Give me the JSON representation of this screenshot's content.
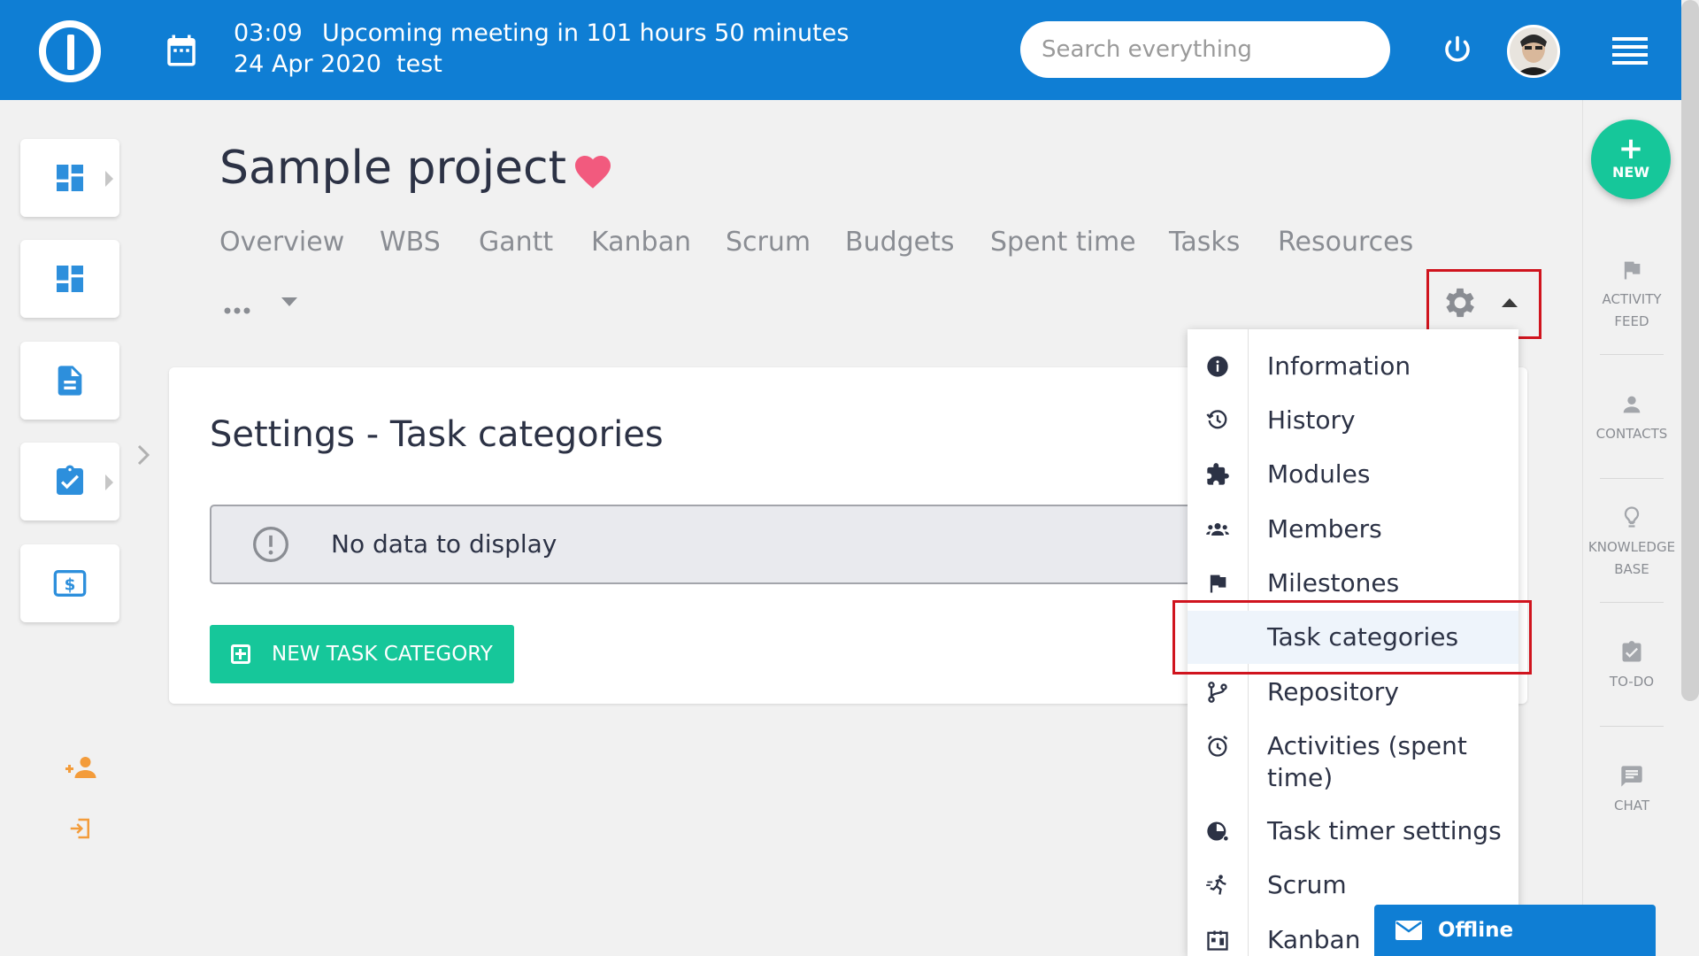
{
  "header": {
    "time": "03:09",
    "meeting": "Upcoming meeting in 101 hours 50 minutes",
    "date": "24 Apr 2020",
    "project": "test",
    "search_placeholder": "Search everything"
  },
  "page": {
    "title": "Sample project",
    "tabs": [
      "Overview",
      "WBS",
      "Gantt",
      "Kanban",
      "Scrum",
      "Budgets",
      "Spent time",
      "Tasks",
      "Resources"
    ],
    "more": "..."
  },
  "card": {
    "title": "Settings - Task categories",
    "nodata": "No data to display",
    "new_button": "NEW TASK CATEGORY"
  },
  "menu": {
    "items": [
      {
        "label": "Information",
        "icon": "info-icon"
      },
      {
        "label": "History",
        "icon": "history-icon"
      },
      {
        "label": "Modules",
        "icon": "puzzle-icon"
      },
      {
        "label": "Members",
        "icon": "members-icon"
      },
      {
        "label": "Milestones",
        "icon": "flag-icon"
      },
      {
        "label": "Task categories",
        "icon": ""
      },
      {
        "label": "Repository",
        "icon": "branch-icon"
      },
      {
        "label": "Activities (spent time)",
        "icon": "alarm-icon"
      },
      {
        "label": "Task timer settings",
        "icon": "timer-icon"
      },
      {
        "label": "Scrum",
        "icon": "runner-icon"
      },
      {
        "label": "Kanban",
        "icon": "board-icon"
      }
    ]
  },
  "right_sidebar": {
    "new": "NEW",
    "activity_feed": [
      "ACTIVITY",
      "FEED"
    ],
    "contacts": "CONTACTS",
    "knowledge_base": [
      "KNOWLEDGE",
      "BASE"
    ],
    "todo": "TO-DO",
    "chat": "CHAT"
  },
  "chat": {
    "status": "Offline"
  },
  "colors": {
    "brand_blue": "#0f7ed4",
    "accent_green": "#16c79a",
    "highlight_red": "#d0141e",
    "heart_pink": "#f25a7e"
  }
}
